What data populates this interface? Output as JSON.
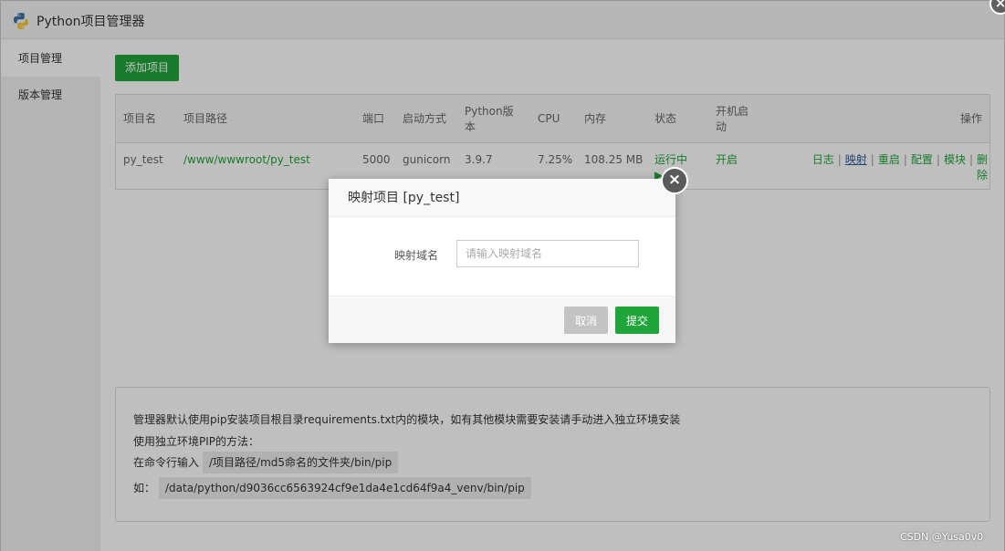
{
  "window": {
    "title": "Python项目管理器",
    "close_icon": "×"
  },
  "sidebar": {
    "items": [
      {
        "label": "项目管理",
        "active": true
      },
      {
        "label": "版本管理",
        "active": false
      }
    ]
  },
  "toolbar": {
    "add_label": "添加项目"
  },
  "table": {
    "headers": {
      "name": "项目名",
      "path": "项目路径",
      "port": "端口",
      "start_mode": "启动方式",
      "python_version": "Python版本",
      "cpu": "CPU",
      "memory": "内存",
      "status": "状态",
      "autostart": "开机启动",
      "actions": "操作"
    },
    "rows": [
      {
        "name": "py_test",
        "path": "/www/wwwroot/py_test",
        "port": "5000",
        "start_mode": "gunicorn",
        "python_version": "3.9.7",
        "cpu": "7.25%",
        "memory": "108.25 MB",
        "status": "运行中",
        "status_icon": "▶",
        "autostart": "开启",
        "actions": {
          "log": "日志",
          "map": "映射",
          "restart": "重启",
          "config": "配置",
          "module": "模块",
          "delete": "删除"
        },
        "separator": "|"
      }
    ]
  },
  "dialog": {
    "title": "映射项目 [py_test]",
    "close_icon": "×",
    "field_label": "映射域名",
    "input_placeholder": "请输入映射域名",
    "input_value": "",
    "cancel_label": "取消",
    "submit_label": "提交"
  },
  "info": {
    "line1": "管理器默认使用pip安装项目根目录requirements.txt内的模块，如有其他模块需要安装请手动进入独立环境安装",
    "line2": "使用独立环境PIP的方法：",
    "line3_prefix": "在命令行输入",
    "line3_code": "/项目路径/md5命名的文件夹/bin/pip",
    "line4_prefix": "如：",
    "line4_code": "/data/python/d9036cc6563924cf9e1da4e1cd64f9a4_venv/bin/pip"
  },
  "watermark": "CSDN @Yusa0v0",
  "colors": {
    "accent": "#20a53a",
    "link": "#2a5b9a",
    "cancel": "#c3c3c3"
  }
}
